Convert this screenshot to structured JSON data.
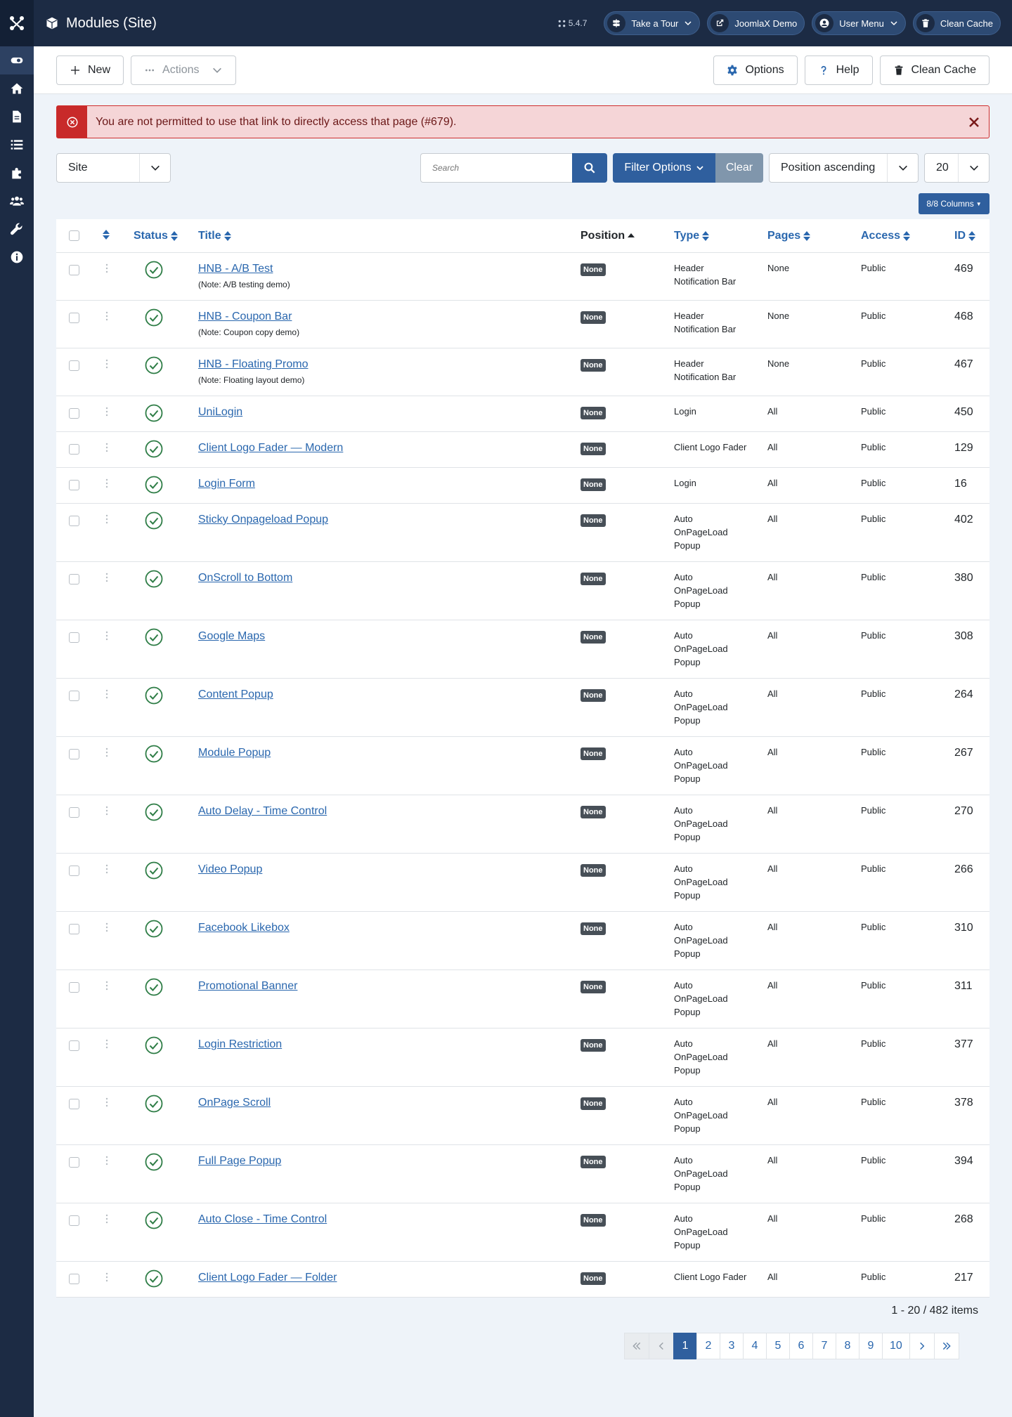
{
  "header": {
    "title": "Modules (Site)",
    "version": "5.4.7",
    "buttons": [
      {
        "label": "Take a Tour"
      },
      {
        "label": "JoomlaX Demo"
      },
      {
        "label": "User Menu"
      },
      {
        "label": "Clean Cache"
      }
    ]
  },
  "toolbar": {
    "new_label": "New",
    "actions_label": "Actions",
    "options_label": "Options",
    "help_label": "Help",
    "clean_cache_label": "Clean Cache"
  },
  "alert": {
    "message": "You are not permitted to use that link to directly access that page (#679)."
  },
  "filters": {
    "client": "Site",
    "search_placeholder": "Search",
    "filter_options_label": "Filter Options",
    "clear_label": "Clear",
    "ordering": "Position ascending",
    "limit": "20",
    "columns_label": "8/8 Columns"
  },
  "table": {
    "headers": {
      "status": "Status",
      "title": "Title",
      "position": "Position",
      "type": "Type",
      "pages": "Pages",
      "access": "Access",
      "id": "ID"
    },
    "rows": [
      {
        "title": "HNB - A/B Test",
        "note": "(Note: A/B testing demo)",
        "position": "None",
        "type": [
          "Header",
          "Notification Bar"
        ],
        "pages": "None",
        "access": "Public",
        "id": "469"
      },
      {
        "title": "HNB - Coupon Bar",
        "note": "(Note: Coupon copy demo)",
        "position": "None",
        "type": [
          "Header",
          "Notification Bar"
        ],
        "pages": "None",
        "access": "Public",
        "id": "468"
      },
      {
        "title": "HNB - Floating Promo",
        "note": "(Note: Floating layout demo)",
        "position": "None",
        "type": [
          "Header",
          "Notification Bar"
        ],
        "pages": "None",
        "access": "Public",
        "id": "467"
      },
      {
        "title": "UniLogin",
        "note": "",
        "position": "None",
        "type": [
          "Login"
        ],
        "pages": "All",
        "access": "Public",
        "id": "450"
      },
      {
        "title": "Client Logo Fader — Modern",
        "note": "",
        "position": "None",
        "type": [
          "Client Logo Fader"
        ],
        "pages": "All",
        "access": "Public",
        "id": "129"
      },
      {
        "title": "Login Form",
        "note": "",
        "position": "None",
        "type": [
          "Login"
        ],
        "pages": "All",
        "access": "Public",
        "id": "16"
      },
      {
        "title": "Sticky Onpageload Popup",
        "note": "",
        "position": "None",
        "type": [
          "Auto",
          "OnPageLoad",
          "Popup"
        ],
        "pages": "All",
        "access": "Public",
        "id": "402"
      },
      {
        "title": "OnScroll to Bottom",
        "note": "",
        "position": "None",
        "type": [
          "Auto",
          "OnPageLoad",
          "Popup"
        ],
        "pages": "All",
        "access": "Public",
        "id": "380"
      },
      {
        "title": "Google Maps",
        "note": "",
        "position": "None",
        "type": [
          "Auto",
          "OnPageLoad",
          "Popup"
        ],
        "pages": "All",
        "access": "Public",
        "id": "308"
      },
      {
        "title": "Content Popup",
        "note": "",
        "position": "None",
        "type": [
          "Auto",
          "OnPageLoad",
          "Popup"
        ],
        "pages": "All",
        "access": "Public",
        "id": "264"
      },
      {
        "title": "Module Popup",
        "note": "",
        "position": "None",
        "type": [
          "Auto",
          "OnPageLoad",
          "Popup"
        ],
        "pages": "All",
        "access": "Public",
        "id": "267"
      },
      {
        "title": "Auto Delay - Time Control",
        "note": "",
        "position": "None",
        "type": [
          "Auto",
          "OnPageLoad",
          "Popup"
        ],
        "pages": "All",
        "access": "Public",
        "id": "270"
      },
      {
        "title": "Video Popup",
        "note": "",
        "position": "None",
        "type": [
          "Auto",
          "OnPageLoad",
          "Popup"
        ],
        "pages": "All",
        "access": "Public",
        "id": "266"
      },
      {
        "title": "Facebook Likebox",
        "note": "",
        "position": "None",
        "type": [
          "Auto",
          "OnPageLoad",
          "Popup"
        ],
        "pages": "All",
        "access": "Public",
        "id": "310"
      },
      {
        "title": "Promotional Banner",
        "note": "",
        "position": "None",
        "type": [
          "Auto",
          "OnPageLoad",
          "Popup"
        ],
        "pages": "All",
        "access": "Public",
        "id": "311"
      },
      {
        "title": "Login Restriction",
        "note": "",
        "position": "None",
        "type": [
          "Auto",
          "OnPageLoad",
          "Popup"
        ],
        "pages": "All",
        "access": "Public",
        "id": "377"
      },
      {
        "title": "OnPage Scroll",
        "note": "",
        "position": "None",
        "type": [
          "Auto",
          "OnPageLoad",
          "Popup"
        ],
        "pages": "All",
        "access": "Public",
        "id": "378"
      },
      {
        "title": "Full Page Popup",
        "note": "",
        "position": "None",
        "type": [
          "Auto",
          "OnPageLoad",
          "Popup"
        ],
        "pages": "All",
        "access": "Public",
        "id": "394"
      },
      {
        "title": "Auto Close - Time Control",
        "note": "",
        "position": "None",
        "type": [
          "Auto",
          "OnPageLoad",
          "Popup"
        ],
        "pages": "All",
        "access": "Public",
        "id": "268"
      },
      {
        "title": "Client Logo Fader — Folder",
        "note": "",
        "position": "None",
        "type": [
          "Client Logo Fader"
        ],
        "pages": "All",
        "access": "Public",
        "id": "217"
      }
    ]
  },
  "pagination": {
    "summary": "1 - 20 / 482 items",
    "pages": [
      "1",
      "2",
      "3",
      "4",
      "5",
      "6",
      "7",
      "8",
      "9",
      "10"
    ],
    "current": "1"
  },
  "colors": {
    "sidebar": "#1c2b44",
    "primary": "#2f5f9e",
    "link": "#2a67ae",
    "success": "#2e7d46",
    "danger": "#c82a2a"
  },
  "icons": {
    "sidebar": [
      "joomla-logo-icon",
      "toggle-icon",
      "home-icon",
      "file-icon",
      "list-icon",
      "puzzle-icon",
      "users-icon",
      "wrench-icon",
      "info-icon"
    ]
  }
}
